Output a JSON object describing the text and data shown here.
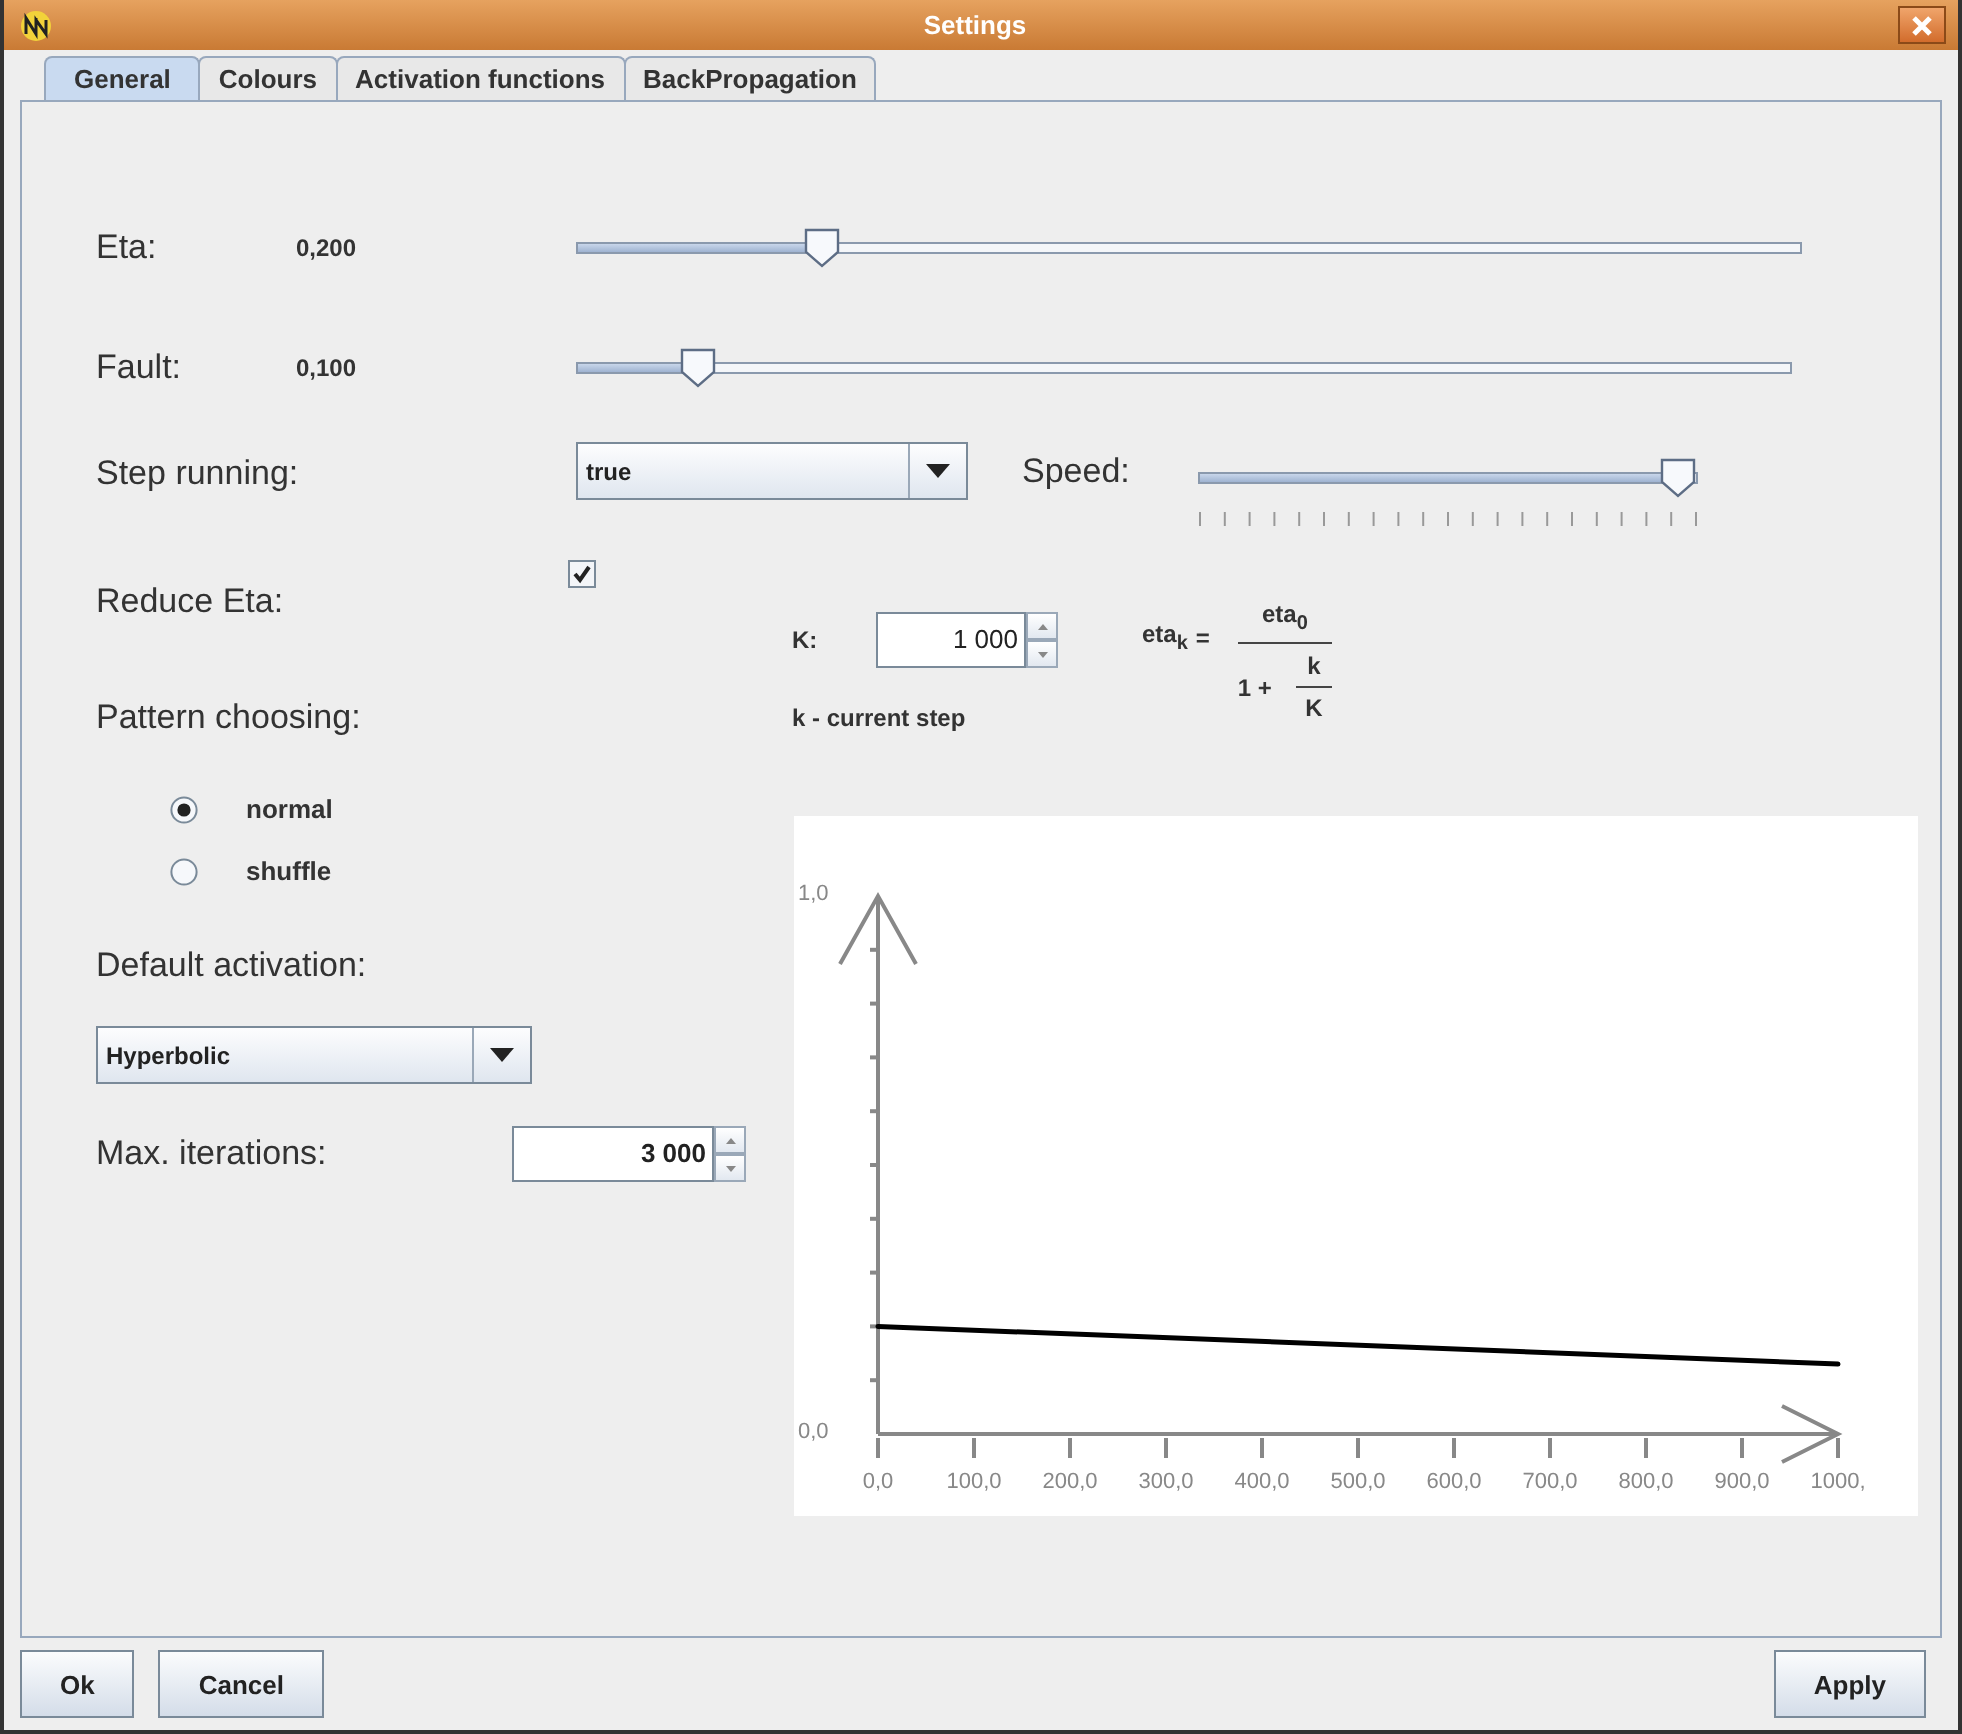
{
  "window": {
    "title": "Settings"
  },
  "tabs": [
    {
      "label": "General",
      "selected": true
    },
    {
      "label": "Colours",
      "selected": false
    },
    {
      "label": "Activation functions",
      "selected": false
    },
    {
      "label": "BackPropagation",
      "selected": false
    }
  ],
  "eta": {
    "label": "Eta:",
    "value": "0,200",
    "level": 0.2
  },
  "fault": {
    "label": "Fault:",
    "value": "0,100",
    "level": 0.1
  },
  "step_running": {
    "label": "Step running:",
    "value": "true"
  },
  "speed": {
    "label": "Speed:",
    "level": 0.96
  },
  "reduce_eta": {
    "label": "Reduce Eta:",
    "checked": true
  },
  "pattern_choosing": {
    "label": "Pattern choosing:",
    "options": [
      {
        "label": "normal",
        "selected": true
      },
      {
        "label": "shuffle",
        "selected": false
      }
    ]
  },
  "default_activation": {
    "label": "Default activation:",
    "value": "Hyperbolic"
  },
  "max_iterations": {
    "label": "Max. iterations:",
    "value": "3 000"
  },
  "k": {
    "label": "K:",
    "value": "1 000",
    "note": "k - current step"
  },
  "formula": {
    "lhs": "eta$_{k}$",
    "equals": "=",
    "numerator": "eta$_{0}$",
    "denominator_lead": "1 +",
    "inner_numerator": "k",
    "inner_denominator": "K"
  },
  "chart": {
    "chart_data": {
      "type": "line",
      "x": [
        0,
        1000
      ],
      "series": [
        {
          "color": "#000000",
          "values": [
            0.2,
            0.13
          ]
        }
      ],
      "xlim": [
        0,
        1000
      ],
      "ylim": [
        0,
        1
      ],
      "xticks": [
        {
          "value": 0,
          "label": "0,0"
        },
        {
          "value": 100,
          "label": "100,0"
        },
        {
          "value": 200,
          "label": "200,0"
        },
        {
          "value": 300,
          "label": "300,0"
        },
        {
          "value": 400,
          "label": "400,0"
        },
        {
          "value": 500,
          "label": "500,0"
        },
        {
          "value": 600,
          "label": "600,0"
        },
        {
          "value": 700,
          "label": "700,0"
        },
        {
          "value": 800,
          "label": "800,0"
        },
        {
          "value": 900,
          "label": "900,0"
        },
        {
          "value": 1000,
          "label": "1000,"
        }
      ],
      "yticks": [
        {
          "value": 0,
          "label": "0,0"
        },
        {
          "value": 1,
          "label": "1,0"
        }
      ]
    }
  },
  "footer": {
    "left_buttons": [
      "Ok",
      "Cancel"
    ],
    "right_buttons": [
      "Apply"
    ]
  }
}
